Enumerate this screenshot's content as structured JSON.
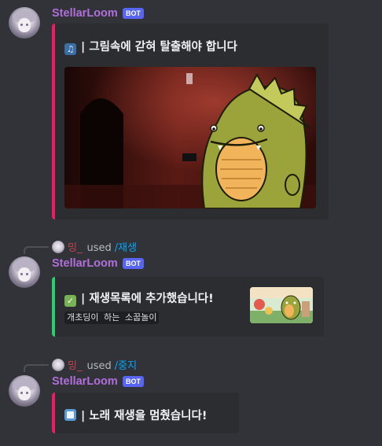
{
  "messages": [
    {
      "author": "StellarLoom",
      "badge": "BOT",
      "embed_icon": "music-notes-icon",
      "embed_title": "| 그림속에 갇혀 탈출해야 합니다",
      "accent": "#e91e63"
    },
    {
      "reply": {
        "user": "밍_",
        "verb": "used",
        "command": "/재생"
      },
      "author": "StellarLoom",
      "badge": "BOT",
      "embed_icon": "check-mark-icon",
      "embed_title": "| 재생목록에 추가했습니다!",
      "embed_desc": "개초딩이 하는 소꿉놀이",
      "accent": "#2ecc71"
    },
    {
      "reply": {
        "user": "밍_",
        "verb": "used",
        "command": "/중지"
      },
      "author": "StellarLoom",
      "badge": "BOT",
      "embed_icon": "stop-square-icon",
      "embed_title": "| 노래 재생을 멈췄습니다!",
      "accent": "#e91e63"
    }
  ],
  "colors": {
    "background": "#313338",
    "embed_bg": "#2b2d31",
    "username": "#b06fd9",
    "bot_badge": "#5865f2",
    "reply_user": "#c1454e",
    "command": "#00a8fc"
  }
}
